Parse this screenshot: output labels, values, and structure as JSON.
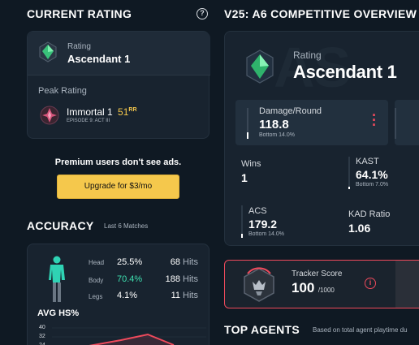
{
  "current_rating": {
    "title": "CURRENT RATING",
    "help_icon": "?",
    "rating_label": "Rating",
    "rating_value": "Ascendant 1",
    "peak_label": "Peak Rating",
    "peak_value": "Immortal 1",
    "peak_rr": "51",
    "peak_rr_unit": "RR",
    "peak_episode": "EPISODE 9: ACT III"
  },
  "ad": {
    "message": "Premium users don't see ads.",
    "upgrade_label": "Upgrade for $3/mo"
  },
  "accuracy": {
    "title": "ACCURACY",
    "subtitle": "Last 6 Matches",
    "rows": [
      {
        "label": "Head",
        "pct": "25.5%",
        "hits": "68",
        "hits_unit": "Hits"
      },
      {
        "label": "Body",
        "pct": "70.4%",
        "hits": "188",
        "hits_unit": "Hits"
      },
      {
        "label": "Legs",
        "pct": "4.1%",
        "hits": "11",
        "hits_unit": "Hits"
      }
    ],
    "avg_hs_label": "AVG HS%",
    "chart_ticks": [
      "40",
      "32",
      "24"
    ]
  },
  "overview": {
    "title": "V25: A6 COMPETITIVE OVERVIEW",
    "rating_label": "Rating",
    "rating_value": "Ascendant 1",
    "stats": {
      "damage": {
        "label": "Damage/Round",
        "value": "118.8",
        "sub": "Bottom 14.0%",
        "level": 0.86
      },
      "wins": {
        "label": "Wins",
        "value": "1"
      },
      "kast": {
        "label": "KAST",
        "value": "64.1%",
        "sub": "Bottom 7.0%",
        "level": 0.93
      },
      "acs": {
        "label": "ACS",
        "value": "179.2",
        "sub": "Bottom 14.0%",
        "level": 0.86
      },
      "kad": {
        "label": "KAD Ratio",
        "value": "1.06"
      }
    },
    "tracker": {
      "label": "Tracker Score",
      "value": "100",
      "max": "/1000"
    }
  },
  "top_agents": {
    "title": "TOP AGENTS",
    "subtitle": "Based on total agent playtime du"
  },
  "colors": {
    "accent_red": "#ef4a5c",
    "gold": "#f5c84c",
    "body_green": "#3ee0b0",
    "figure_teal": "#2fd3b4"
  }
}
